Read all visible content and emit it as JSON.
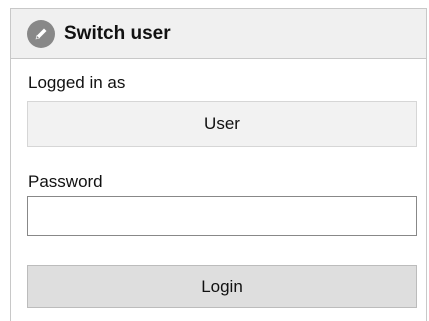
{
  "header": {
    "title": "Switch user",
    "icon": "pencil-icon"
  },
  "logged_in": {
    "label": "Logged in as",
    "value": "User"
  },
  "password": {
    "label": "Password",
    "value": "",
    "placeholder": ""
  },
  "login_button": {
    "label": "Login"
  },
  "colors": {
    "header_bg": "#f0f0f0",
    "icon_bg": "#888888",
    "button_bg": "#dedede"
  }
}
